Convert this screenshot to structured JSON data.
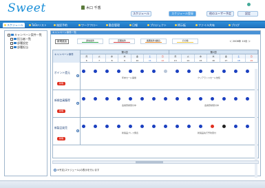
{
  "app": {
    "logo": "Sweet",
    "user_name": "木口 千香"
  },
  "top_buttons": [
    {
      "label": "スケジュール",
      "active": false
    },
    {
      "label": "スケジュール登録",
      "active": true
    },
    {
      "label": "他のユーザー予定",
      "active": false
    },
    {
      "label": "設定",
      "active": false
    }
  ],
  "nav": [
    {
      "label": "スケジュール",
      "active": true
    },
    {
      "label": "ToDoリスト",
      "active": false
    },
    {
      "label": "施設予約",
      "active": false
    },
    {
      "label": "ワークフロー",
      "active": false
    },
    {
      "label": "勤怠管理",
      "active": false
    },
    {
      "label": "日報",
      "active": false
    },
    {
      "label": "プロジェクト",
      "active": false
    },
    {
      "label": "掲示板",
      "active": false
    },
    {
      "label": "ファイル共有",
      "active": false
    },
    {
      "label": "ブログ",
      "active": false
    }
  ],
  "left_tree": [
    {
      "label": "キャンペーン案件一覧"
    },
    {
      "label": "担当者一覧"
    },
    {
      "label": "部署設定"
    },
    {
      "label": "部署担当"
    }
  ],
  "main": {
    "title": "キャンペーン案件一覧",
    "new_button": "新規追加",
    "legends": [
      {
        "label": "通常案件",
        "color": "#2fa84f"
      },
      {
        "label": "定期案件",
        "color": "#d84040"
      },
      {
        "label": "長期案件(継続)",
        "color": "#e88a2a"
      },
      {
        "label": "その他",
        "color": "#f0c840"
      }
    ],
    "month": "＜ 2008年 10月 ＞"
  },
  "grid": {
    "col_head": "キャンペーン案件",
    "weeks": [
      "第1週",
      "第2週"
    ],
    "days": [
      "月",
      "火",
      "水",
      "木",
      "金",
      "土",
      "日",
      "月",
      "火",
      "水",
      "木",
      "金",
      "土",
      "日"
    ],
    "dates": [
      "6",
      "7",
      "8",
      "9",
      "10",
      "11",
      "12",
      "13",
      "14",
      "15",
      "16",
      "17",
      "18",
      "19"
    ],
    "rows": [
      {
        "name": "ポイント還元",
        "tag": "新規",
        "text_left": "年末セール開催",
        "text_right": "クリアランスセール告知"
      },
      {
        "name": "新規会員獲得",
        "tag": "新規",
        "text_left": "会員登録受付中",
        "text_right": "会員登録受付中"
      },
      {
        "name": "新製品発売",
        "tag": "新規",
        "text_left": "新製品プレス発表",
        "text_right": "新製品先行予約受付"
      }
    ]
  },
  "footer_note": "※予定(スケジュール)の表示を行います"
}
